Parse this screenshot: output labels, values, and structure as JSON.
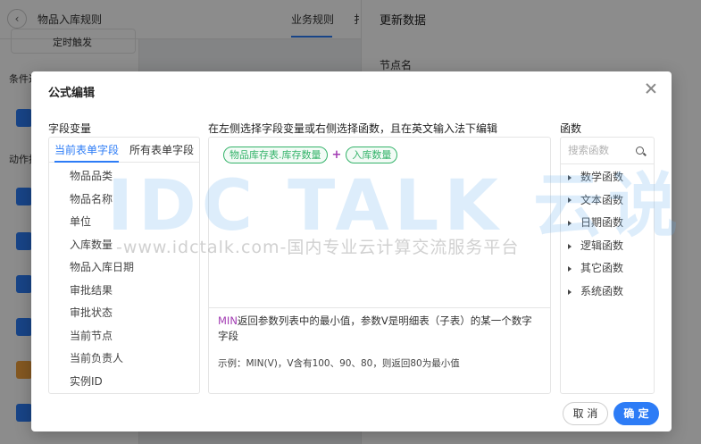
{
  "background": {
    "page_title": "物品入库规则",
    "tabs": [
      "业务规则",
      "扌"
    ],
    "sidebar_labels": [
      "条件过",
      "动作执"
    ],
    "card_text": "定时触发",
    "right_panel": {
      "title": "更新数据",
      "node_name_label": "节点名"
    }
  },
  "dialog": {
    "title": "公式编辑",
    "field_panel": {
      "label": "字段变量",
      "tabs": [
        "当前表单字段",
        "所有表单字段"
      ],
      "items": [
        "物品品类",
        "物品名称",
        "单位",
        "入库数量",
        "物品入库日期",
        "审批结果",
        "审批状态",
        "当前节点",
        "当前负责人",
        "实例ID"
      ]
    },
    "editor": {
      "hint": "在左侧选择字段变量或右侧选择函数，且在英文输入法下编辑",
      "formula": {
        "chip1": "物品库存表.库存数量",
        "operator": "+",
        "chip2": "入库数量"
      },
      "description_fn": "MIN",
      "description_text": "返回参数列表中的最小值，参数V是明细表（子表）的某一个数字字段",
      "example": "示例：MIN(V)，V含有100、90、80，则返回80为最小值"
    },
    "function_panel": {
      "label": "函数",
      "search_placeholder": "搜索函数",
      "items": [
        "数学函数",
        "文本函数",
        "日期函数",
        "逻辑函数",
        "其它函数",
        "系统函数"
      ]
    },
    "buttons": {
      "cancel": "取 消",
      "ok": "确 定"
    }
  },
  "watermark": {
    "logo": "IDC TALK 云说",
    "url": "-www.idctalk.com-国内专业云计算交流服务平台"
  },
  "colors": {
    "primary": "#2d7cf6",
    "chip_green": "#34b36a",
    "function_purple": "#a23cb3"
  }
}
